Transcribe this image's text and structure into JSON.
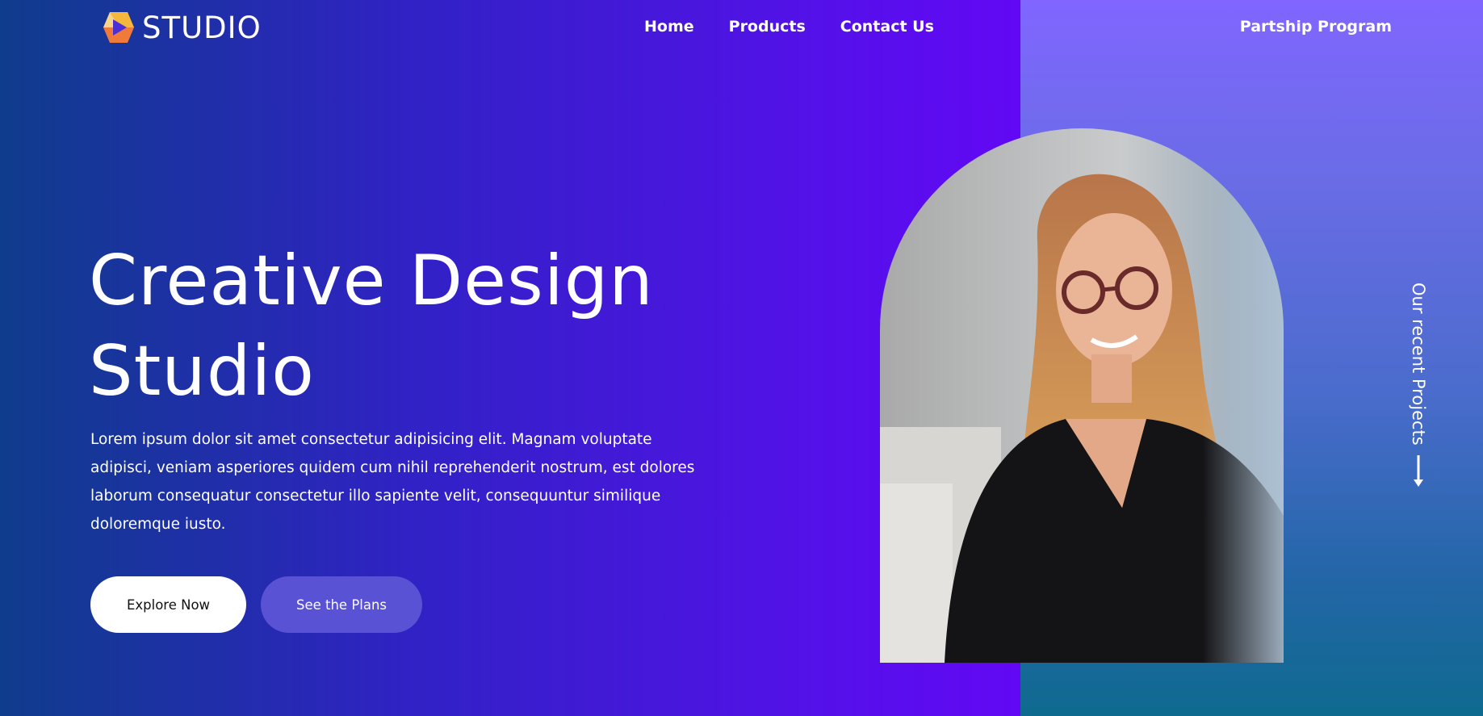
{
  "brand": {
    "name": "STUDIO",
    "logo_icon": "play-hexagon-icon",
    "logo_colors": [
      "#f5b73c",
      "#f07a3a",
      "#f6d48a"
    ]
  },
  "nav": {
    "items": [
      {
        "label": "Home"
      },
      {
        "label": "Products"
      },
      {
        "label": "Contact Us"
      }
    ],
    "partner_label": "Partship Program"
  },
  "hero": {
    "title_line1": "Creative Design",
    "title_line2": "Studio",
    "description": "Lorem ipsum dolor sit amet consectetur adipisicing elit. Magnam voluptate adipisci, veniam asperiores quidem cum nihil reprehenderit nostrum, est dolores laborum consequatur consectetur illo sapiente velit, consequuntur similique doloremque iusto.",
    "primary_button": "Explore Now",
    "secondary_button": "See the Plans"
  },
  "side": {
    "label": "Our recent Projects",
    "arrow_icon": "arrow-down-icon"
  },
  "colors": {
    "accent": "#630af2",
    "panel_top": "#8066ff",
    "panel_bottom": "#0e6a8f",
    "secondary_button": "#5a52d4"
  }
}
